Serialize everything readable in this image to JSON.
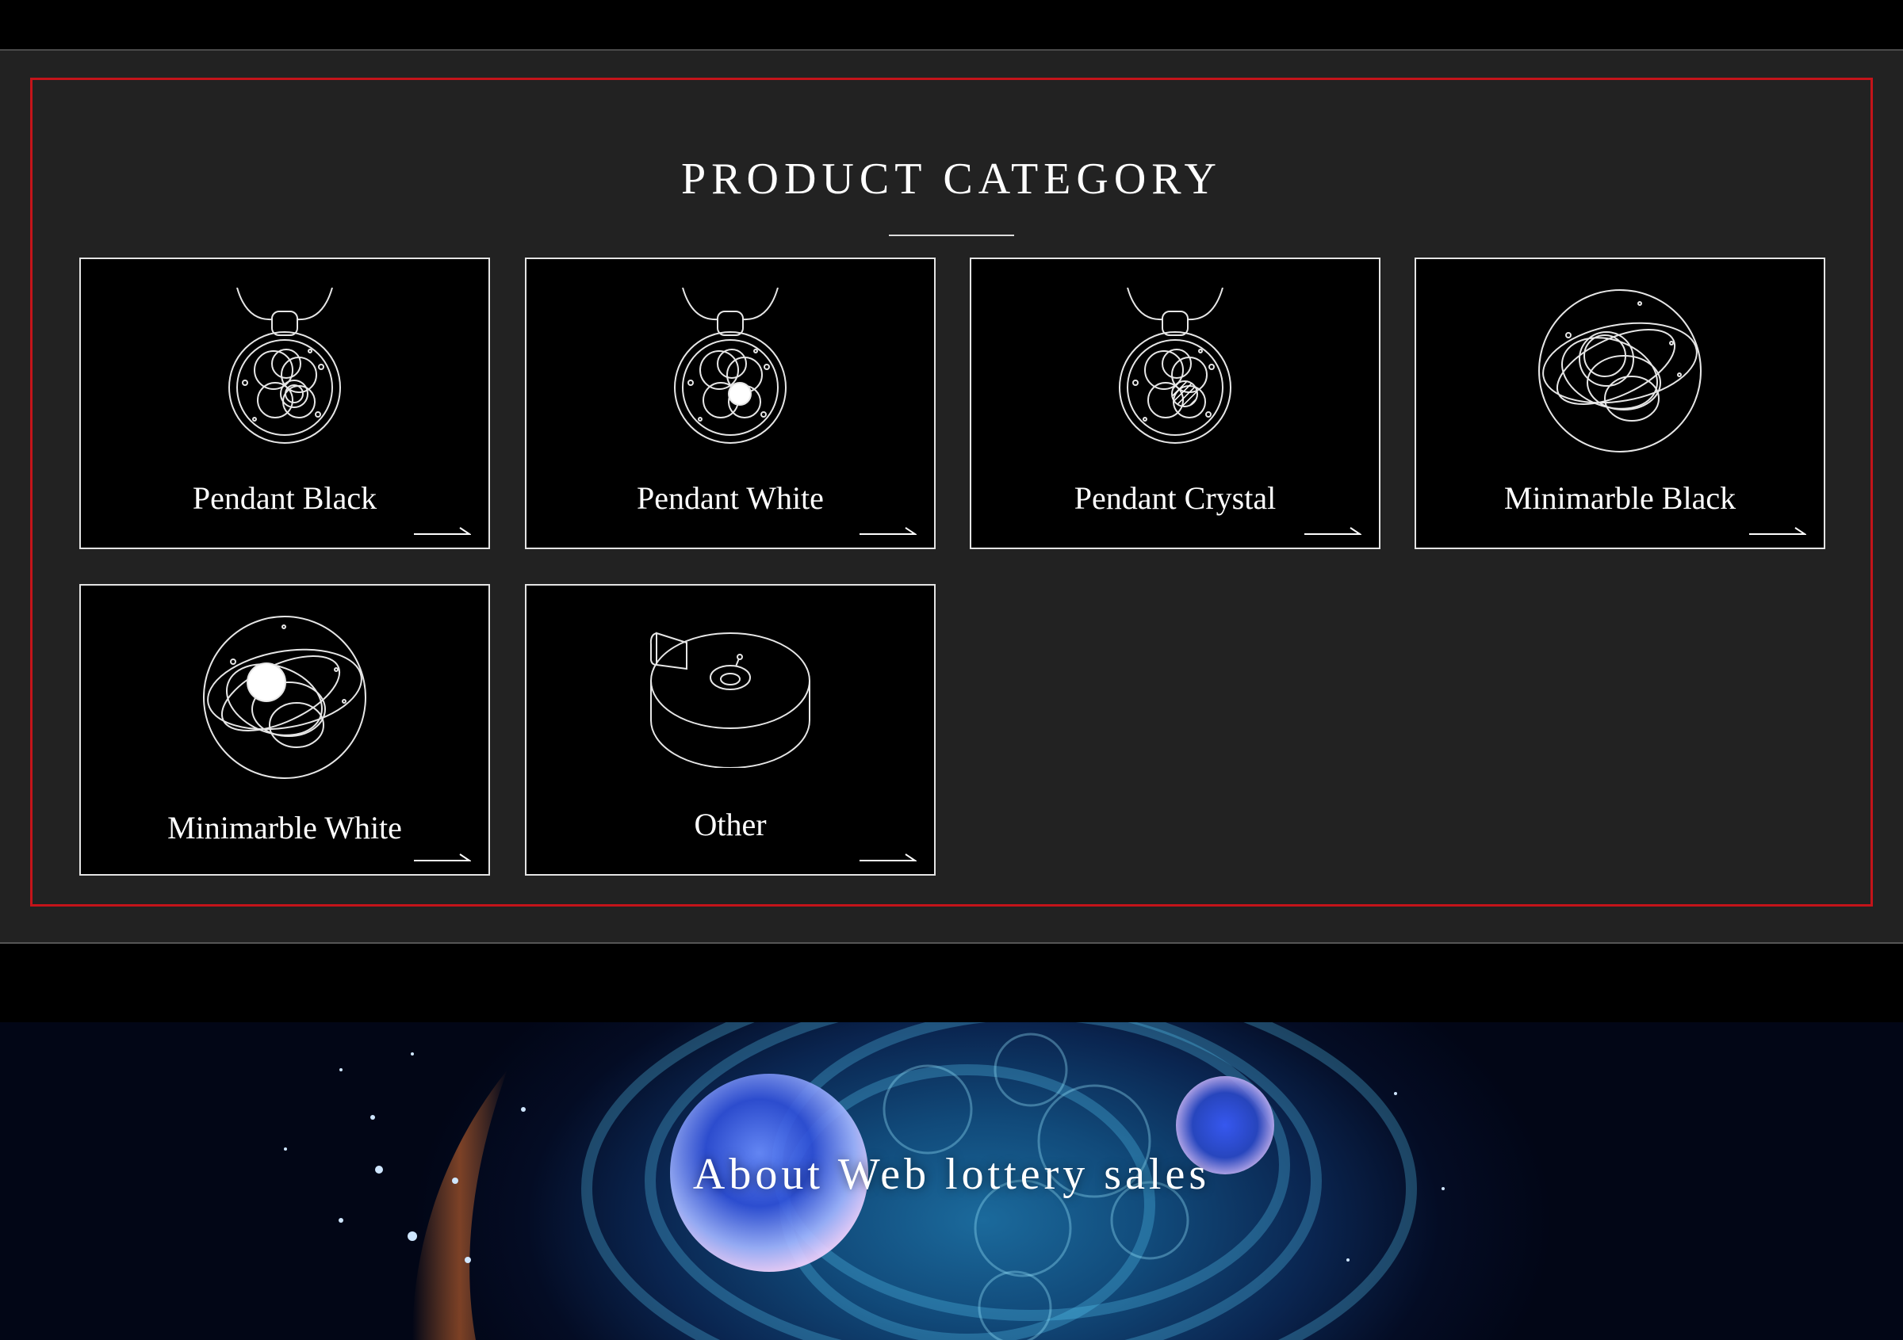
{
  "section": {
    "title": "PRODUCT CATEGORY"
  },
  "categories": [
    {
      "label": "Pendant Black",
      "icon": "pendant-black-icon"
    },
    {
      "label": "Pendant White",
      "icon": "pendant-white-icon"
    },
    {
      "label": "Pendant Crystal",
      "icon": "pendant-crystal-icon"
    },
    {
      "label": "Minimarble Black",
      "icon": "minimarble-black-icon"
    },
    {
      "label": "Minimarble White",
      "icon": "minimarble-white-icon"
    },
    {
      "label": "Other",
      "icon": "other-product-icon"
    }
  ],
  "banner": {
    "title": "About Web lottery sales"
  },
  "colors": {
    "page_background": "#000000",
    "panel_background": "#222222",
    "card_background": "#000000",
    "card_border": "#e4e4e4",
    "highlight_border": "#c4141a",
    "text": "#ffffff"
  }
}
